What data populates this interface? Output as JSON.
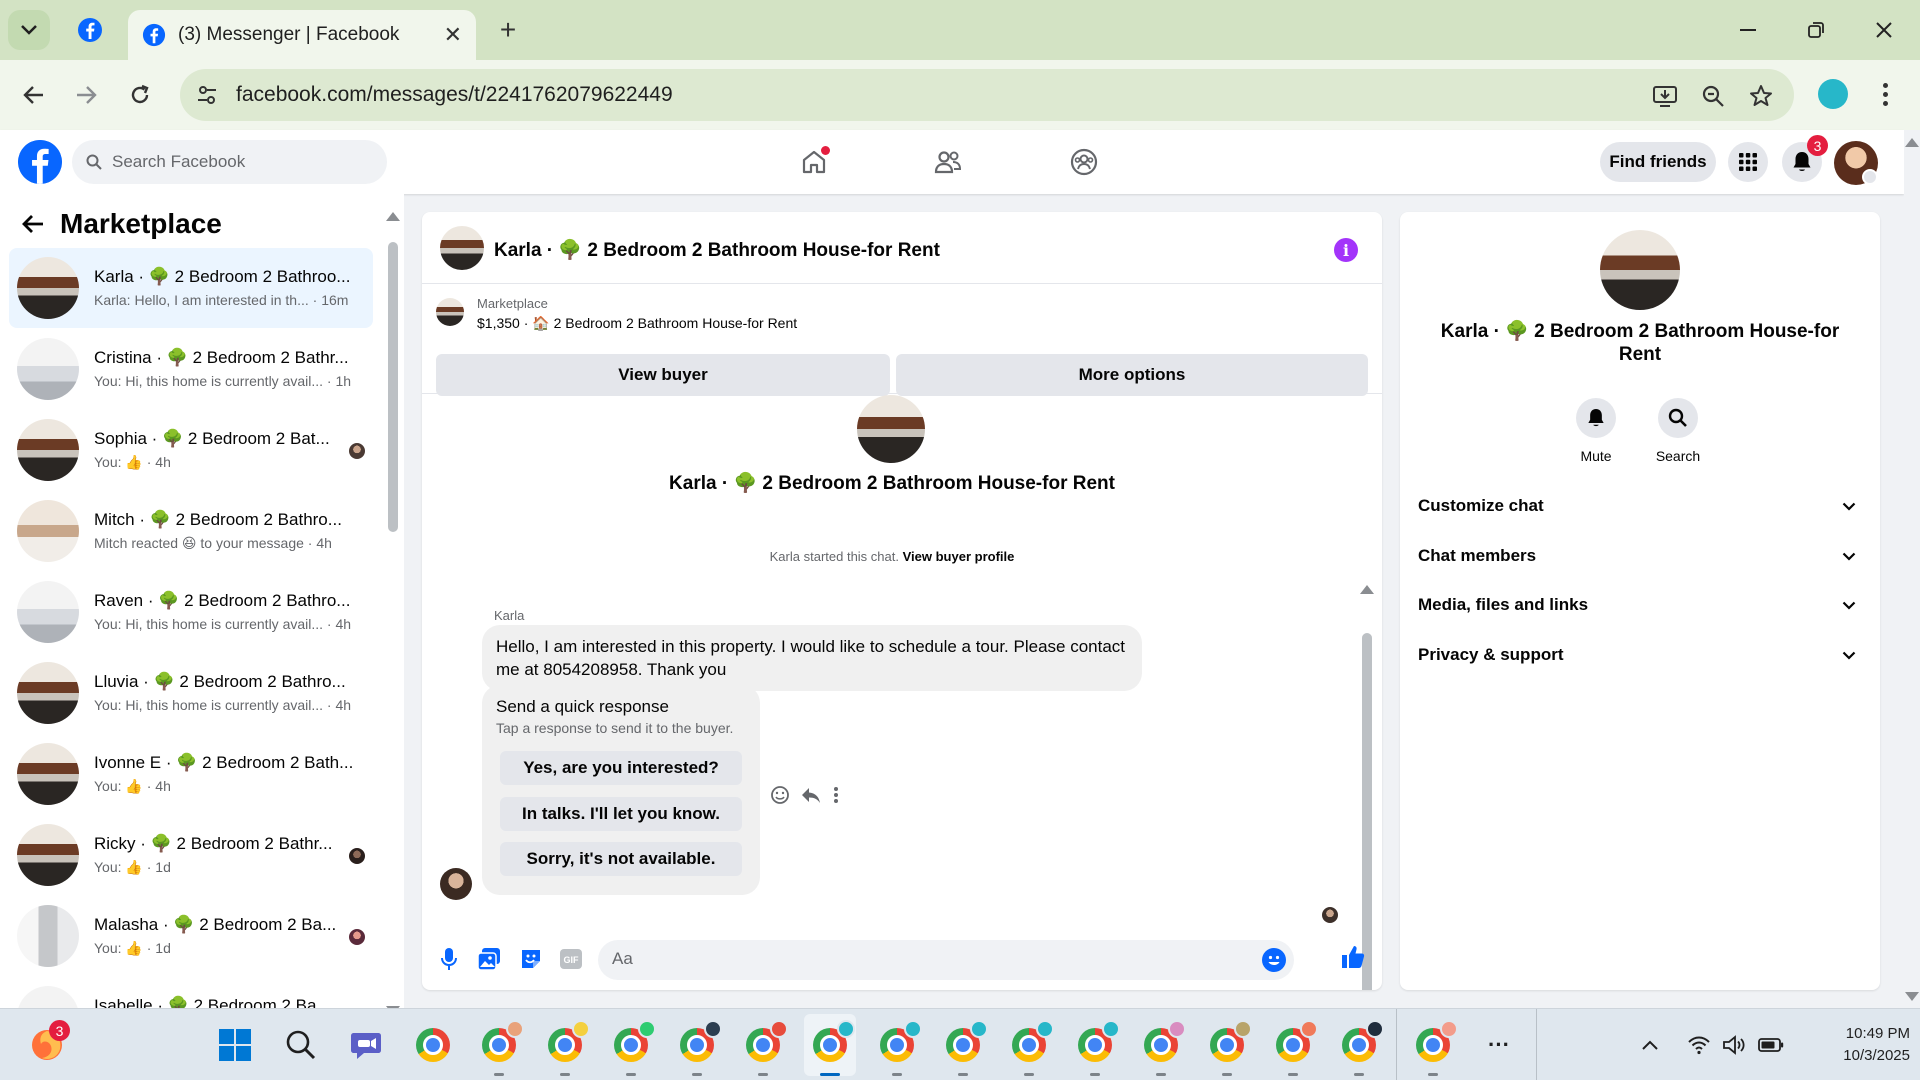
{
  "browser": {
    "tab_title": "(3) Messenger | Facebook",
    "url": "facebook.com/messages/t/2241762079622449",
    "new_tab_symbol": "+",
    "close_symbol": "✕"
  },
  "fb_header": {
    "search_placeholder": "Search Facebook",
    "find_friends": "Find friends",
    "notification_count": "3"
  },
  "left_panel": {
    "title": "Marketplace",
    "threads": [
      {
        "name": "Karla · 🌳 2 Bedroom 2 Bathroo...",
        "snippet": "Karla: Hello, I am interested in th... · 16m",
        "active": true
      },
      {
        "name": "Cristina · 🌳 2 Bedroom 2 Bathr...",
        "snippet": "You: Hi, this home is currently avail... · 1h"
      },
      {
        "name": "Sophia · 🌳 2 Bedroom 2 Bat...",
        "snippet": "You: 👍 · 4h"
      },
      {
        "name": "Mitch · 🌳 2 Bedroom 2 Bathro...",
        "snippet": "Mitch reacted 😆 to your message · 4h"
      },
      {
        "name": "Raven · 🌳 2 Bedroom 2 Bathro...",
        "snippet": "You: Hi, this home is currently avail... · 4h"
      },
      {
        "name": "Lluvia · 🌳 2 Bedroom 2 Bathro...",
        "snippet": "You: Hi, this home is currently avail... · 4h"
      },
      {
        "name": "Ivonne E · 🌳 2 Bedroom 2 Bath...",
        "snippet": "You: 👍 · 4h"
      },
      {
        "name": "Ricky · 🌳 2 Bedroom 2 Bathr...",
        "snippet": "You: 👍 · 1d"
      },
      {
        "name": "Malasha · 🌳 2 Bedroom 2 Ba...",
        "snippet": "You: 👍 · 1d"
      },
      {
        "name": "Isabelle · 🌳 2 Bedroom 2 Ba...",
        "snippet": ""
      }
    ]
  },
  "chat": {
    "title": "Karla · 🌳 2 Bedroom 2 Bathroom House-for Rent",
    "marketplace_label": "Marketplace",
    "listing": "$1,350 · 🏠 2 Bedroom 2 Bathroom House-for Rent",
    "view_buyer": "View buyer",
    "more_options": "More options",
    "conversation_title": "Karla · 🌳 2 Bedroom 2 Bathroom House-for Rent",
    "started_text": "Karla started this chat.",
    "view_buyer_profile": "View buyer profile",
    "sender": "Karla",
    "message": "Hello, I am interested in this property. I would like to schedule a tour. Please contact me at 8054208958. Thank you",
    "quick_response_title": "Send a quick response",
    "quick_response_sub": "Tap a response to send it to the buyer.",
    "quick_responses": [
      "Yes, are you interested?",
      "In talks. I'll let you know.",
      "Sorry, it's not available."
    ],
    "composer_placeholder": "Aa"
  },
  "right_panel": {
    "title": "Karla · 🌳 2 Bedroom 2 Bathroom House-for Rent",
    "mute": "Mute",
    "search": "Search",
    "sections": [
      "Customize chat",
      "Chat members",
      "Media, files and links",
      "Privacy & support"
    ]
  },
  "taskbar": {
    "firefox_badge": "3",
    "time": "10:49 PM",
    "date": "10/3/2025",
    "more": "···"
  },
  "colors": {
    "facebook_blue": "#0866ff",
    "info_purple": "#a334fa",
    "badge_red": "#e41e3f",
    "tab_strip": "#d3e3c4"
  },
  "icons": {
    "back": "arrow-left-icon",
    "forward": "arrow-right-icon",
    "reload": "reload-icon",
    "home": "home-icon",
    "friends": "friends-icon",
    "groups": "groups-icon",
    "menu": "grid-menu-icon",
    "notifications": "bell-icon",
    "mic": "mic-icon",
    "photo": "photo-icon",
    "sticker": "sticker-icon",
    "gif": "gif-icon",
    "like": "thumbs-up-icon"
  }
}
